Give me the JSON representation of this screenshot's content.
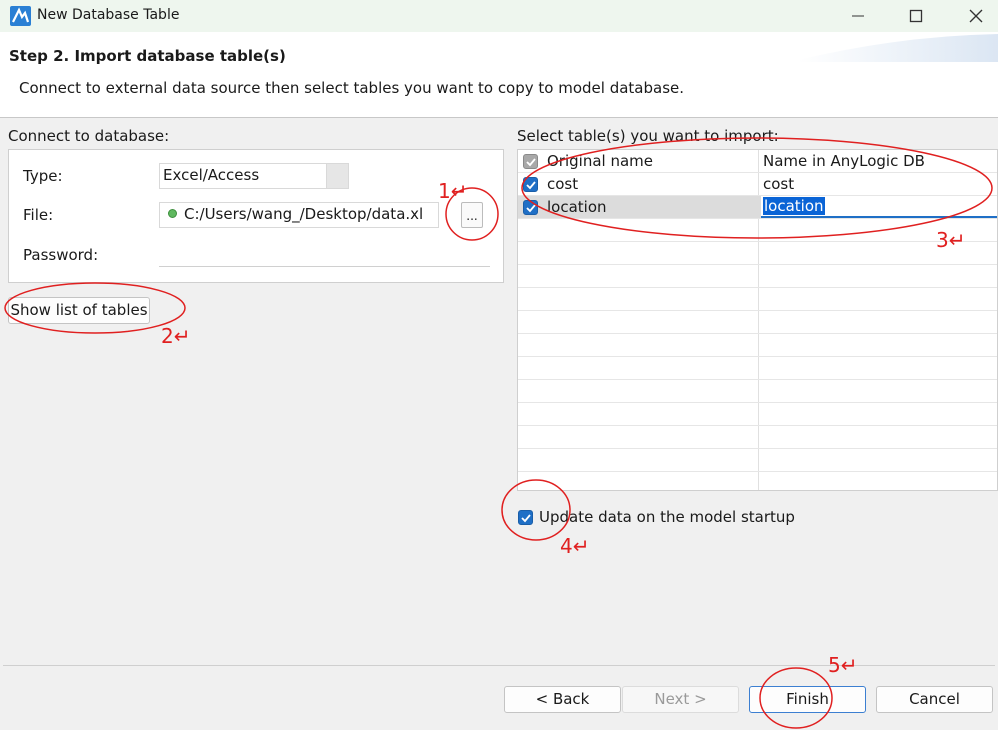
{
  "window": {
    "title": "New Database Table",
    "icon": "anylogic-logo-icon",
    "controls": [
      "minimize-icon",
      "maximize-icon",
      "close-icon"
    ]
  },
  "header": {
    "step_title": "Step 2. Import database table(s)",
    "description": "Connect to external data source then select tables you want to copy to model database."
  },
  "connect": {
    "section_label": "Connect to database:",
    "type_label": "Type:",
    "type_value": "Excel/Access",
    "file_label": "File:",
    "file_value": "C:/Users/wang_/Desktop/data.xl",
    "browse_label": "...",
    "password_label": "Password:",
    "password_value": "",
    "show_tables_button": "Show list of tables"
  },
  "tables": {
    "section_label": "Select table(s) you want to import:",
    "columns": [
      "Original name",
      "Name in AnyLogic DB"
    ],
    "rows": [
      {
        "original": "cost",
        "anylogic_name": "cost",
        "checked": true
      },
      {
        "original": "location",
        "anylogic_name": "location",
        "checked": true
      }
    ]
  },
  "options": {
    "update_label": "Update data on the model startup",
    "update_checked": true
  },
  "footer": {
    "back": "< Back",
    "next": "Next >",
    "finish": "Finish",
    "cancel": "Cancel"
  },
  "annotations": {
    "n1": "1↵",
    "n2": "2↵",
    "n3": "3↵",
    "n4": "4↵",
    "n5": "5↵",
    "color": "#e02020"
  },
  "colors": {
    "accent": "#1f6fc6",
    "titlebar": "#eef6ee"
  }
}
